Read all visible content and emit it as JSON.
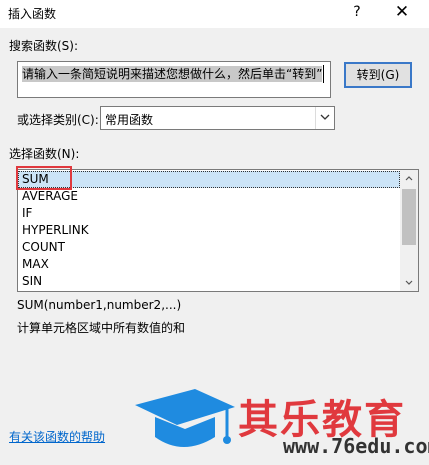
{
  "window": {
    "title": "插入函数",
    "help_glyph": "?",
    "close_glyph": "✕"
  },
  "search": {
    "label": "搜索函数(S):",
    "value": "请输入一条简短说明来描述您想做什么，然后单击“转到”",
    "goto_label": "转到(G)"
  },
  "category": {
    "label": "或选择类别(C):",
    "value": "常用函数"
  },
  "functions": {
    "label": "选择函数(N):",
    "items": [
      "SUM",
      "AVERAGE",
      "IF",
      "HYPERLINK",
      "COUNT",
      "MAX",
      "SIN"
    ],
    "selected": "SUM"
  },
  "details": {
    "signature": "SUM(number1,number2,...)",
    "description": "计算单元格区域中所有数值的和"
  },
  "help_link": "有关该函数的帮助",
  "watermark": {
    "brand": "其乐教育",
    "url": "www.76edu.com"
  },
  "colors": {
    "accent": "#3a78c8",
    "highlight": "#e0393e",
    "selection": "#cce4f7",
    "link": "#0066cc",
    "brand_blue": "#1f8be0"
  }
}
